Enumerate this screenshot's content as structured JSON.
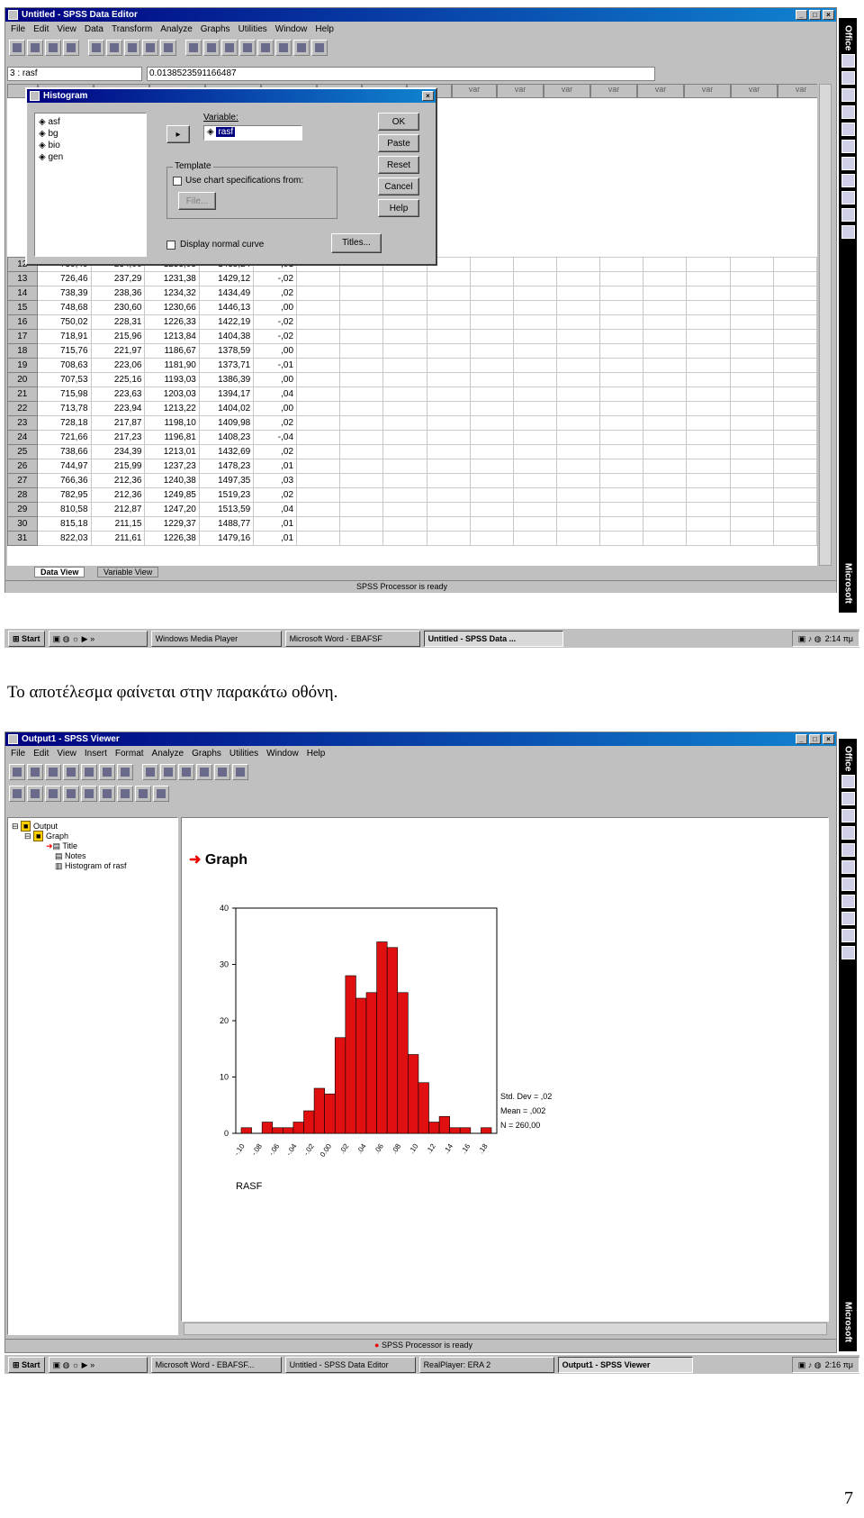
{
  "screen1": {
    "title": "Untitled - SPSS Data Editor",
    "menu": [
      "File",
      "Edit",
      "View",
      "Data",
      "Transform",
      "Analyze",
      "Graphs",
      "Utilities",
      "Window",
      "Help"
    ],
    "cell_ref": "3 : rasf",
    "cell_value": "0.0138523591166487",
    "col_header": "var",
    "rows": [
      [
        "12",
        "739,49",
        "234,06",
        "1233,03",
        "1435,24",
        ",01"
      ],
      [
        "13",
        "726,46",
        "237,29",
        "1231,38",
        "1429,12",
        "-,02"
      ],
      [
        "14",
        "738,39",
        "238,36",
        "1234,32",
        "1434,49",
        ",02"
      ],
      [
        "15",
        "748,68",
        "230,60",
        "1230,66",
        "1446,13",
        ",00"
      ],
      [
        "16",
        "750,02",
        "228,31",
        "1226,33",
        "1422,19",
        "-,02"
      ],
      [
        "17",
        "718,91",
        "215,96",
        "1213,84",
        "1404,38",
        "-,02"
      ],
      [
        "18",
        "715,76",
        "221,97",
        "1186,67",
        "1378,59",
        ",00"
      ],
      [
        "19",
        "708,63",
        "223,06",
        "1181,90",
        "1373,71",
        "-,01"
      ],
      [
        "20",
        "707,53",
        "225,16",
        "1193,03",
        "1386,39",
        ",00"
      ],
      [
        "21",
        "715,98",
        "223,63",
        "1203,03",
        "1394,17",
        ",04"
      ],
      [
        "22",
        "713,78",
        "223,94",
        "1213,22",
        "1404,02",
        ",00"
      ],
      [
        "23",
        "728,18",
        "217,87",
        "1198,10",
        "1409,98",
        ",02"
      ],
      [
        "24",
        "721,66",
        "217,23",
        "1196,81",
        "1408,23",
        "-,04"
      ],
      [
        "25",
        "738,66",
        "234,39",
        "1213,01",
        "1432,69",
        ",02"
      ],
      [
        "26",
        "744,97",
        "215,99",
        "1237,23",
        "1478,23",
        ",01"
      ],
      [
        "27",
        "766,36",
        "212,36",
        "1240,38",
        "1497,35",
        ",03"
      ],
      [
        "28",
        "782,95",
        "212,36",
        "1249,85",
        "1519,23",
        ",02"
      ],
      [
        "29",
        "810,58",
        "212,87",
        "1247,20",
        "1513,59",
        ",04"
      ],
      [
        "30",
        "815,18",
        "211,15",
        "1229,37",
        "1488,77",
        ",01"
      ],
      [
        "31",
        "822,03",
        "211,61",
        "1226,38",
        "1479,16",
        ",01"
      ]
    ],
    "tabs": {
      "data_view": "Data View",
      "variable_view": "Variable View"
    },
    "status": "SPSS Processor  is ready",
    "dialog": {
      "title": "Histogram",
      "vars": [
        "asf",
        "bg",
        "bio",
        "gen"
      ],
      "variable_label": "Variable:",
      "variable_value": "rasf",
      "template_label": "Template",
      "use_spec": "Use chart specifications from:",
      "file_btn": "File...",
      "normal_curve": "Display normal curve",
      "titles_btn": "Titles...",
      "ok": "OK",
      "paste": "Paste",
      "reset": "Reset",
      "cancel": "Cancel",
      "help": "Help"
    },
    "taskbar": {
      "start": "Start",
      "items": [
        "Windows Media Player",
        "Microsoft Word - EBAFSF",
        "Untitled - SPSS Data ..."
      ],
      "time": "2:14 πμ"
    }
  },
  "caption": "Το αποτέλεσμα φαίνεται στην παρακάτω οθόνη.",
  "screen2": {
    "title": "Output1 - SPSS Viewer",
    "menu": [
      "File",
      "Edit",
      "View",
      "Insert",
      "Format",
      "Analyze",
      "Graphs",
      "Utilities",
      "Window",
      "Help"
    ],
    "tree": {
      "output": "Output",
      "graph": "Graph",
      "title": "Title",
      "notes": "Notes",
      "histogram": "Histogram of rasf"
    },
    "heading": "Graph",
    "status": "SPSS Processor  is ready",
    "taskbar": {
      "start": "Start",
      "items": [
        "Microsoft Word - EBAFSF...",
        "Untitled - SPSS Data Editor",
        "RealPlayer: ERA 2",
        "Output1 - SPSS Viewer"
      ],
      "time": "2:16 πμ"
    }
  },
  "office": {
    "label": "Office",
    "brand": "Microsoft"
  },
  "chart_data": {
    "type": "bar",
    "xlabel": "RASF",
    "ylim": [
      0,
      40
    ],
    "yticks": [
      0,
      10,
      20,
      30,
      40
    ],
    "xticks": [
      "-.10",
      "-.08",
      "-.06",
      "-.04",
      "-.02",
      "0.00",
      ".02",
      ".04",
      ".06",
      ".08",
      ".10",
      ".12",
      ".14",
      ".16",
      ".18"
    ],
    "values": [
      1,
      0,
      2,
      1,
      1,
      2,
      4,
      8,
      7,
      17,
      28,
      24,
      25,
      34,
      33,
      25,
      14,
      9,
      2,
      3,
      1,
      1,
      0,
      1
    ],
    "stats": [
      "Std. Dev = ,02",
      "Mean = ,002",
      "N = 260,00"
    ],
    "bar_color": "#e01010"
  },
  "page_number": "7"
}
